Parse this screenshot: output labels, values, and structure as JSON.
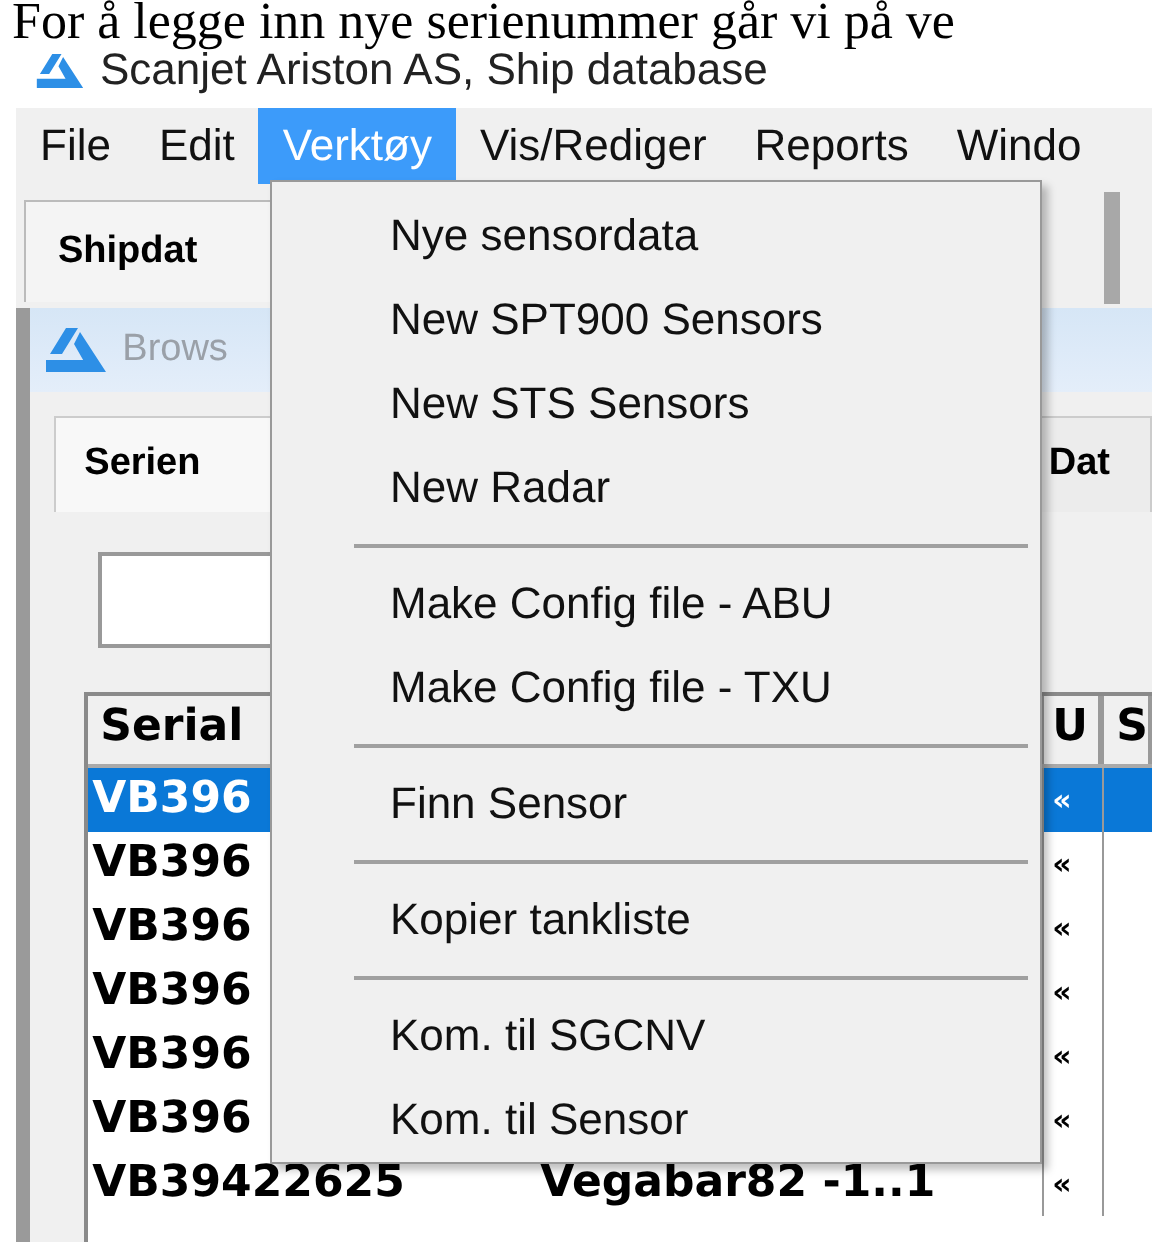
{
  "document_text": "For å legge inn nye serienummer går vi på ve",
  "window": {
    "title": "Scanjet Ariston AS, Ship database"
  },
  "menu_bar": [
    {
      "label": "File",
      "selected": false
    },
    {
      "label": "Edit",
      "selected": false
    },
    {
      "label": "Verktøy",
      "selected": true
    },
    {
      "label": "Vis/Rediger",
      "selected": false
    },
    {
      "label": "Reports",
      "selected": false
    },
    {
      "label": "Windo",
      "selected": false
    }
  ],
  "document_tab": {
    "label": "Shipdat"
  },
  "child_window": {
    "title": "Brows",
    "tabs": [
      {
        "label": "Serien",
        "selected": true
      },
      {
        "label": "Dat",
        "selected": false
      }
    ],
    "table": {
      "columns": [
        {
          "label": "Serial"
        },
        {
          "label": "U"
        },
        {
          "label": "S"
        }
      ],
      "rows": [
        {
          "serial": "VB396",
          "u": "«",
          "selected": true
        },
        {
          "serial": "VB396",
          "u": "«",
          "selected": false
        },
        {
          "serial": "VB396",
          "u": "«",
          "selected": false
        },
        {
          "serial": "VB396",
          "u": "«",
          "selected": false
        },
        {
          "serial": "VB396",
          "u": "«",
          "selected": false
        },
        {
          "serial": "VB396",
          "u": "«",
          "selected": false
        },
        {
          "serial": "VB39422625",
          "column_2": "Vegabar82 -1..1",
          "u": "«",
          "selected": false
        }
      ]
    }
  },
  "dropdown_menu": {
    "items": [
      {
        "kind": "item",
        "label": "Nye sensordata"
      },
      {
        "kind": "item",
        "label": "New SPT900 Sensors"
      },
      {
        "kind": "item",
        "label": "New STS Sensors"
      },
      {
        "kind": "item",
        "label": "New Radar"
      },
      {
        "kind": "separator"
      },
      {
        "kind": "item",
        "label": "Make Config file - ABU"
      },
      {
        "kind": "item",
        "label": "Make Config file - TXU"
      },
      {
        "kind": "separator"
      },
      {
        "kind": "item",
        "label": "Finn Sensor"
      },
      {
        "kind": "separator"
      },
      {
        "kind": "item",
        "label": "Kopier tankliste"
      },
      {
        "kind": "separator"
      },
      {
        "kind": "item",
        "label": "Kom. til SGCNV"
      },
      {
        "kind": "item",
        "label": "Kom. til Sensor"
      }
    ]
  }
}
